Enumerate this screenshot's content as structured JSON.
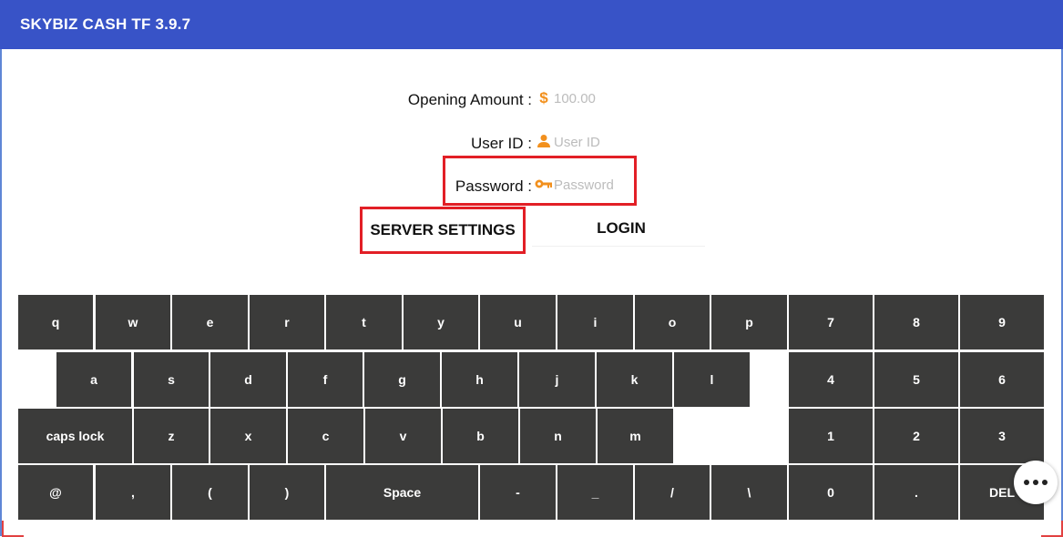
{
  "app": {
    "title": "SKYBIZ CASH TF 3.9.7"
  },
  "form": {
    "opening_amount": {
      "label": "Opening Amount :",
      "icon": "dollar-icon",
      "placeholder": "100.00"
    },
    "user_id": {
      "label": "User ID :",
      "icon": "person-icon",
      "placeholder": "User ID"
    },
    "password": {
      "label": "Password :",
      "icon": "key-icon",
      "placeholder": "Password"
    }
  },
  "buttons": {
    "server_settings": "SERVER SETTINGS",
    "login": "LOGIN"
  },
  "keyboard": {
    "row1": [
      "q",
      "w",
      "e",
      "r",
      "t",
      "y",
      "u",
      "i",
      "o",
      "p"
    ],
    "row2": [
      "a",
      "s",
      "d",
      "f",
      "g",
      "h",
      "j",
      "k",
      "l"
    ],
    "row3": [
      "caps lock",
      "z",
      "x",
      "c",
      "v",
      "b",
      "n",
      "m"
    ],
    "row4": [
      "@",
      ",",
      "(",
      ")",
      "Space",
      "-",
      "_",
      "/",
      "\\"
    ],
    "numpad": [
      [
        "7",
        "8",
        "9"
      ],
      [
        "4",
        "5",
        "6"
      ],
      [
        "1",
        "2",
        "3"
      ],
      [
        "0",
        ".",
        "DEL"
      ]
    ]
  },
  "colors": {
    "header": "#3853c7",
    "accent": "#f2901d",
    "key": "#3b3b3a",
    "highlight": "#e21f26"
  },
  "overlay": {
    "more_button_icon": "more-horizontal-icon"
  }
}
